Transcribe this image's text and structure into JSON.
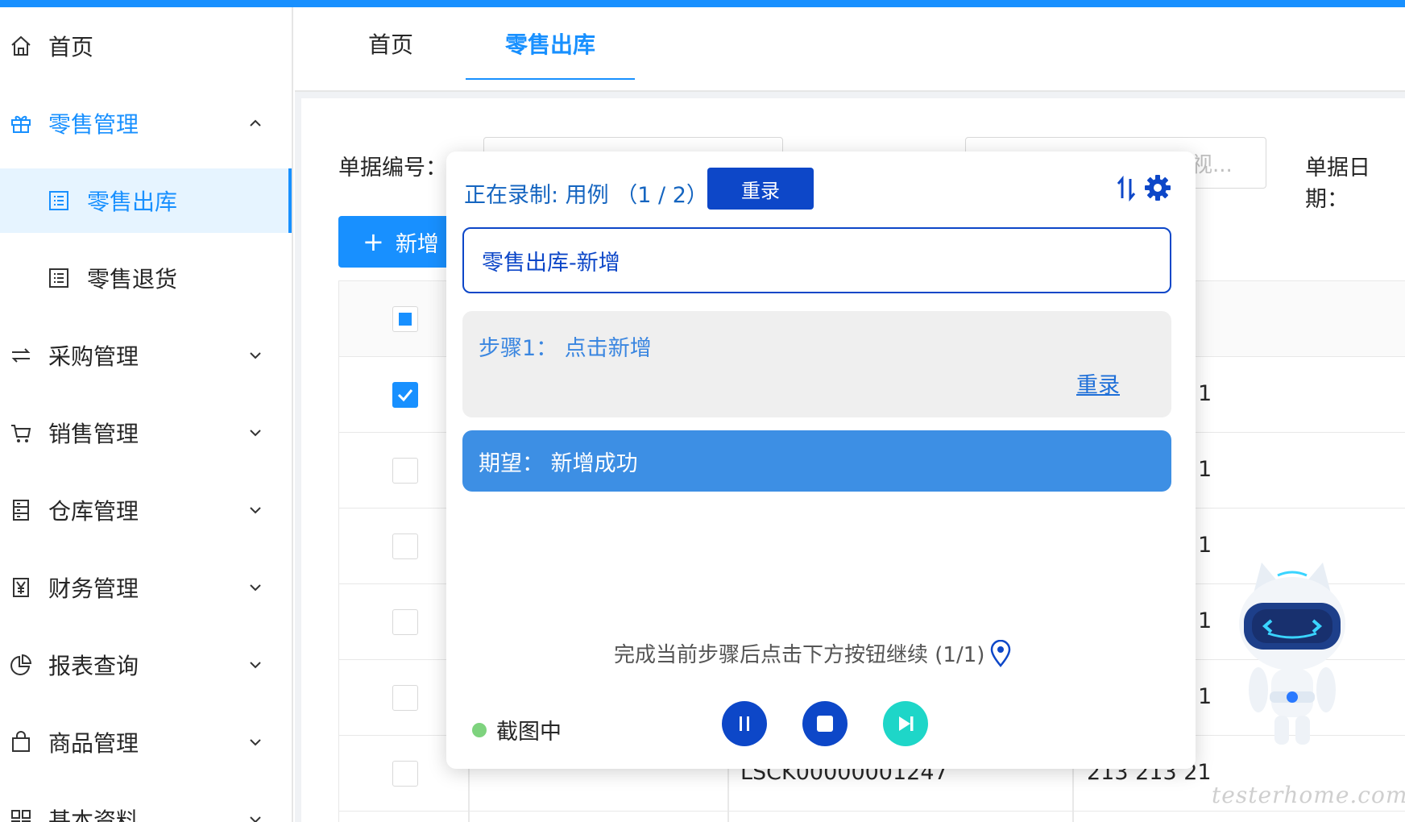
{
  "sidebar": {
    "items": [
      {
        "label": "首页",
        "icon": "home-icon"
      },
      {
        "label": "零售管理",
        "icon": "gift-icon",
        "expanded": true,
        "children": [
          {
            "label": "零售出库",
            "icon": "list-icon",
            "selected": true
          },
          {
            "label": "零售退货",
            "icon": "list-icon"
          }
        ]
      },
      {
        "label": "采购管理",
        "icon": "swap-icon"
      },
      {
        "label": "销售管理",
        "icon": "cart-icon"
      },
      {
        "label": "仓库管理",
        "icon": "warehouse-icon"
      },
      {
        "label": "财务管理",
        "icon": "yen-icon"
      },
      {
        "label": "报表查询",
        "icon": "pie-chart-icon"
      },
      {
        "label": "商品管理",
        "icon": "shopping-bag-icon"
      },
      {
        "label": "基本资料",
        "icon": "grid-icon"
      }
    ]
  },
  "tabs": [
    {
      "label": "首页",
      "active": false
    },
    {
      "label": "零售出库",
      "active": true
    }
  ],
  "filters": {
    "bill_no_label": "单据编号：",
    "hidden_placeholder": "视...",
    "bill_date_label": "单据日期："
  },
  "toolbar": {
    "add_label": "新增"
  },
  "table": {
    "rows": [
      {
        "checked": true,
        "tail": "1"
      },
      {
        "checked": false,
        "tail": "1"
      },
      {
        "checked": false,
        "tail": "1"
      },
      {
        "checked": false,
        "tail": "1"
      },
      {
        "checked": false,
        "tail": "1"
      },
      {
        "checked": false,
        "bill_no": "LSCK00000001247",
        "amount": "213 213 21"
      }
    ]
  },
  "recorder": {
    "title": "正在录制: 用例 （1 / 2）",
    "rerecord_label": "重录",
    "case_name": "零售出库-新增",
    "step": {
      "text": "步骤1： 点击新增",
      "link": "重录"
    },
    "expect": "期望：  新增成功",
    "hint": "完成当前步骤后点击下方按钮继续 (1/1)",
    "status": "截图中",
    "colors": {
      "primary": "#0d47c8",
      "accent": "#3d8fe4",
      "play": "#1ed6c8",
      "status_dot": "#7ed37e"
    }
  },
  "watermark": "testerhome.com",
  "colors": {
    "brand": "#1890ff"
  }
}
